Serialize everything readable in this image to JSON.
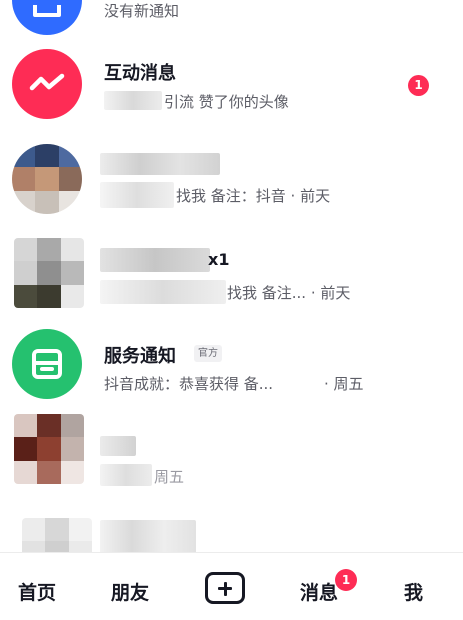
{
  "messages": {
    "notifications_row": {
      "subtitle": "没有新通知",
      "icon": "bell-icon",
      "color": "#2f6bff"
    },
    "interaction_row": {
      "title": "互动消息",
      "subtitle_visible": "引流 赞了你的头像",
      "badge": "1",
      "icon": "zigzag-message-icon",
      "color": "#fe2c55"
    },
    "contact_row_1": {
      "subtitle_visible": "找我 备注：抖音 · 前天"
    },
    "contact_row_2": {
      "title_visible": "x1",
      "subtitle_visible": "找我 备注... · 前天"
    },
    "service_row": {
      "title": "服务通知",
      "tag": "官方",
      "subtitle": "抖音成就：恭喜获得 备...",
      "time": "· 周五",
      "icon": "inbox-icon",
      "color": "#25c16f"
    },
    "contact_row_3": {
      "subtitle_visible": "周五"
    }
  },
  "tabbar": {
    "home": "首页",
    "friends": "朋友",
    "create_icon": "plus-icon",
    "messages": "消息",
    "messages_badge": "1",
    "me": "我"
  },
  "colors": {
    "accent": "#fe2c55",
    "text_primary": "#161823",
    "text_secondary": "#5c5d66"
  }
}
